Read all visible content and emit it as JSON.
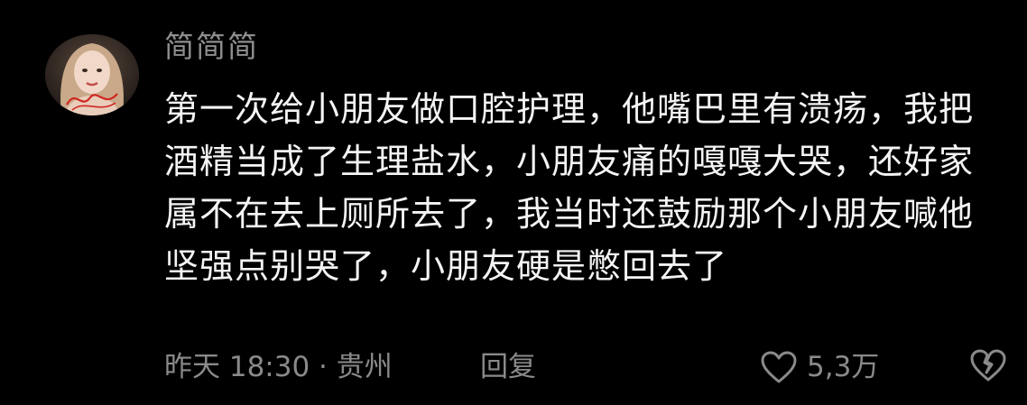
{
  "comment": {
    "username": "简简简",
    "text": "第一次给小朋友做口腔护理，他嘴巴里有溃疡，我把酒精当成了生理盐水，小朋友痛的嘎嘎大哭，还好家属不在去上厕所去了，我当时还鼓励那个小朋友喊他坚强点别哭了，小朋友硬是憋回去了",
    "time_location": "昨天 18:30 · 贵州",
    "reply_label": "回复",
    "like_count": "5,3万",
    "icons": {
      "like": "heart-icon",
      "dislike": "broken-heart-icon"
    }
  },
  "colors": {
    "background": "#000000",
    "text": "#f4f4f4",
    "secondary_text": "#8a8a8a"
  }
}
